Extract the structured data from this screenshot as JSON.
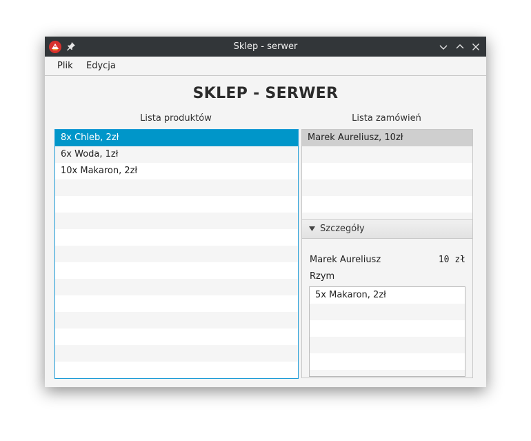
{
  "window": {
    "title": "Sklep - serwer",
    "icons": [
      "app-icon",
      "pin-icon",
      "minimize-icon",
      "maximize-icon",
      "close-icon"
    ]
  },
  "menu": {
    "items": [
      "Plik",
      "Edycja"
    ]
  },
  "heading": "SKLEP - SERWER",
  "products": {
    "label": "Lista produktów",
    "items": [
      "8x Chleb, 2zł",
      "6x Woda, 1zł",
      "10x Makaron, 2zł"
    ],
    "selected_index": 0
  },
  "orders": {
    "label": "Lista zamówień",
    "items": [
      "Marek Aureliusz, 10zł"
    ],
    "selected_index": 0
  },
  "details": {
    "header": "Szczegóły",
    "customer": "Marek Aureliusz",
    "total": "10 zł",
    "city": "Rzym",
    "items": [
      "5x Makaron, 2zł"
    ]
  },
  "colors": {
    "titlebar": "#323639",
    "selection_focused": "#0096c9",
    "selection_unfocused": "#cfcfcf",
    "focus_border": "#1a9ad6"
  }
}
